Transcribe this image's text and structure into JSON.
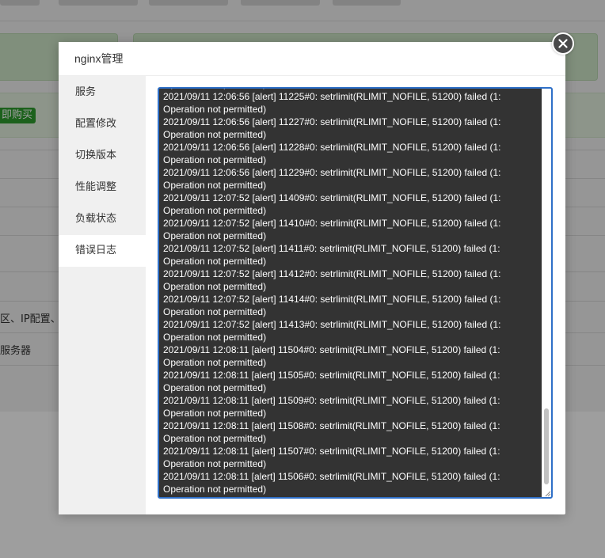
{
  "background": {
    "buy_button": "即购买",
    "row_text_1": "区、IP配置、山",
    "row_text_2": "服务器"
  },
  "modal": {
    "title": "nginx管理",
    "close_icon": "close-icon"
  },
  "sidebar": {
    "items": [
      {
        "label": "服务",
        "active": false
      },
      {
        "label": "配置修改",
        "active": false
      },
      {
        "label": "切换版本",
        "active": false
      },
      {
        "label": "性能调整",
        "active": false
      },
      {
        "label": "负载状态",
        "active": false
      },
      {
        "label": "错误日志",
        "active": true
      }
    ]
  },
  "log": {
    "lines": [
      "Operation not permitted)",
      "2021/09/11 12:06:56 [alert] 11225#0: setrlimit(RLIMIT_NOFILE, 51200) failed (1:",
      "Operation not permitted)",
      "2021/09/11 12:06:56 [alert] 11227#0: setrlimit(RLIMIT_NOFILE, 51200) failed (1:",
      "Operation not permitted)",
      "2021/09/11 12:06:56 [alert] 11228#0: setrlimit(RLIMIT_NOFILE, 51200) failed (1:",
      "Operation not permitted)",
      "2021/09/11 12:06:56 [alert] 11229#0: setrlimit(RLIMIT_NOFILE, 51200) failed (1:",
      "Operation not permitted)",
      "2021/09/11 12:07:52 [alert] 11409#0: setrlimit(RLIMIT_NOFILE, 51200) failed (1:",
      "Operation not permitted)",
      "2021/09/11 12:07:52 [alert] 11410#0: setrlimit(RLIMIT_NOFILE, 51200) failed (1:",
      "Operation not permitted)",
      "2021/09/11 12:07:52 [alert] 11411#0: setrlimit(RLIMIT_NOFILE, 51200) failed (1:",
      "Operation not permitted)",
      "2021/09/11 12:07:52 [alert] 11412#0: setrlimit(RLIMIT_NOFILE, 51200) failed (1:",
      "Operation not permitted)",
      "2021/09/11 12:07:52 [alert] 11414#0: setrlimit(RLIMIT_NOFILE, 51200) failed (1:",
      "Operation not permitted)",
      "2021/09/11 12:07:52 [alert] 11413#0: setrlimit(RLIMIT_NOFILE, 51200) failed (1:",
      "Operation not permitted)",
      "2021/09/11 12:08:11 [alert] 11504#0: setrlimit(RLIMIT_NOFILE, 51200) failed (1:",
      "Operation not permitted)",
      "2021/09/11 12:08:11 [alert] 11505#0: setrlimit(RLIMIT_NOFILE, 51200) failed (1:",
      "Operation not permitted)",
      "2021/09/11 12:08:11 [alert] 11509#0: setrlimit(RLIMIT_NOFILE, 51200) failed (1:",
      "Operation not permitted)",
      "2021/09/11 12:08:11 [alert] 11508#0: setrlimit(RLIMIT_NOFILE, 51200) failed (1:",
      "Operation not permitted)",
      "2021/09/11 12:08:11 [alert] 11507#0: setrlimit(RLIMIT_NOFILE, 51200) failed (1:",
      "Operation not permitted)",
      "2021/09/11 12:08:11 [alert] 11506#0: setrlimit(RLIMIT_NOFILE, 51200) failed (1:",
      "Operation not permitted)"
    ]
  },
  "colors": {
    "accent": "#2f70c8",
    "log_background": "#333333",
    "log_text": "#ffffff",
    "buy_button": "#2e9d2e"
  }
}
